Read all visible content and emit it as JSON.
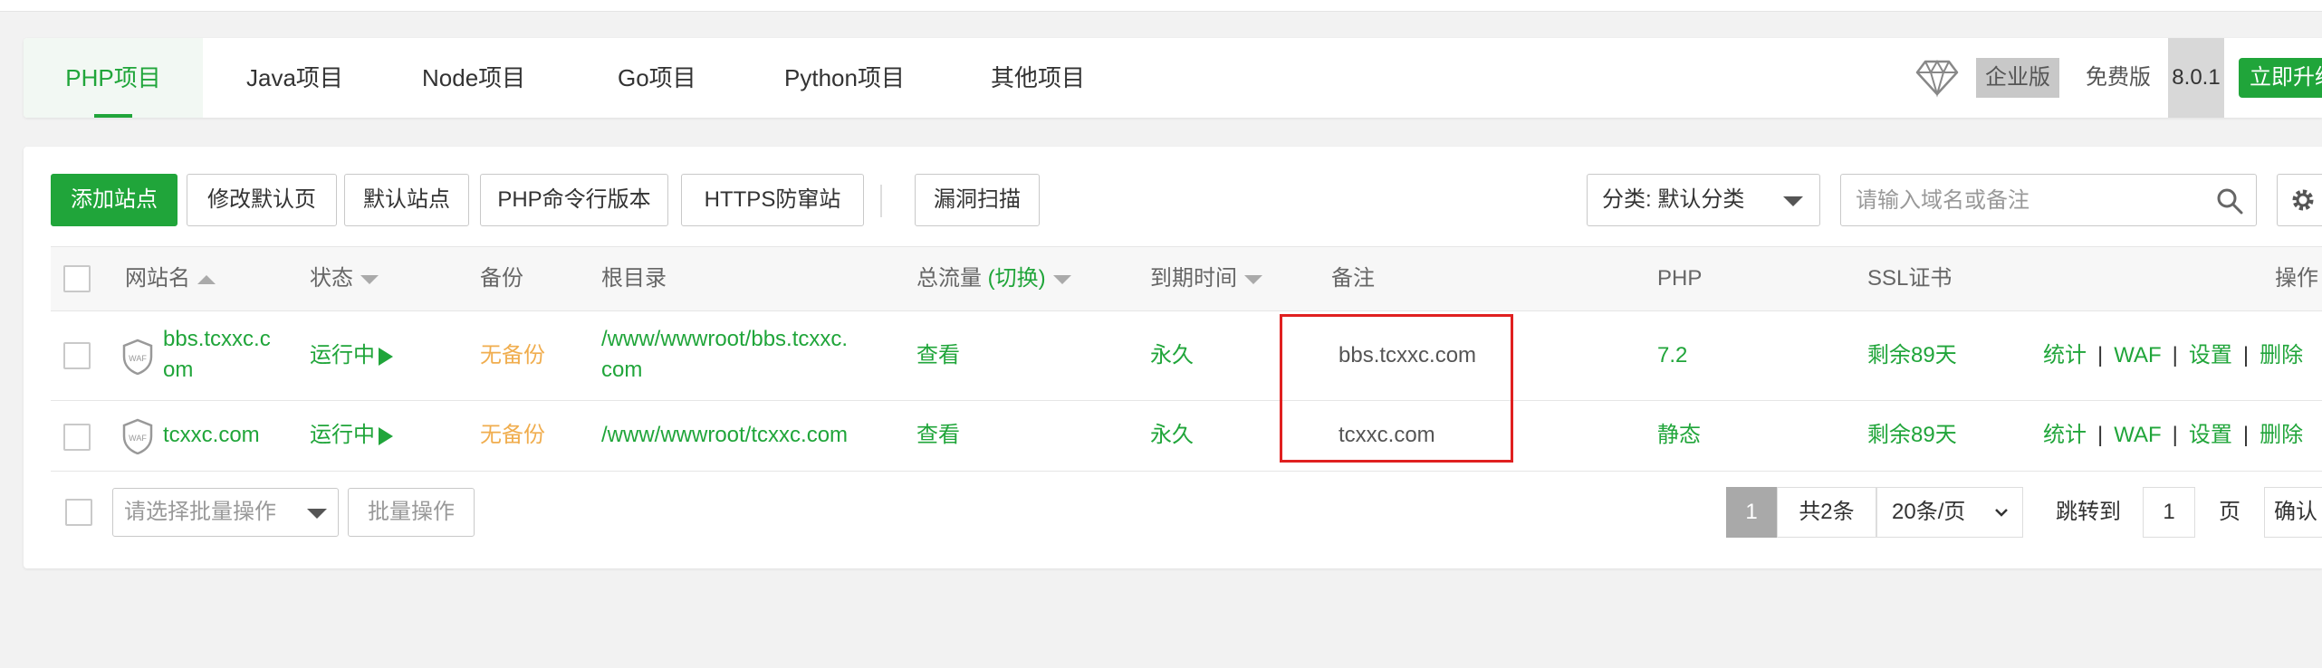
{
  "tabs": [
    {
      "label": "PHP项目",
      "active": true
    },
    {
      "label": "Java项目"
    },
    {
      "label": "Node项目"
    },
    {
      "label": "Go项目"
    },
    {
      "label": "Python项目"
    },
    {
      "label": "其他项目"
    }
  ],
  "header": {
    "enterprise_label": "企业版",
    "free_label": "免费版",
    "version": "8.0.1",
    "upgrade_label": "立即升级"
  },
  "toolbar": {
    "add_site": "添加站点",
    "edit_default_page": "修改默认页",
    "default_site": "默认站点",
    "php_cli_version": "PHP命令行版本",
    "https_antiproxy": "HTTPS防窜站",
    "vuln_scan": "漏洞扫描",
    "category": "分类: 默认分类",
    "search_placeholder": "请输入域名或备注"
  },
  "table": {
    "headers": {
      "site_name": "网站名",
      "status": "状态",
      "backup": "备份",
      "root_dir": "根目录",
      "traffic": "总流量",
      "traffic_toggle": "(切换)",
      "expiry": "到期时间",
      "note": "备注",
      "php": "PHP",
      "ssl": "SSL证书",
      "actions": "操作"
    },
    "rows": [
      {
        "site_line1": "bbs.tcxxc.c",
        "site_line2": "om",
        "status": "运行中",
        "backup": "无备份",
        "root_line1": "/www/wwwroot/bbs.tcxxc.",
        "root_line2": "com",
        "traffic": "查看",
        "expiry": "永久",
        "note": "bbs.tcxxc.com",
        "php": "7.2",
        "ssl": "剩余89天",
        "actions": [
          "统计",
          "WAF",
          "设置",
          "删除"
        ]
      },
      {
        "site": "tcxxc.com",
        "status": "运行中",
        "backup": "无备份",
        "root": "/www/wwwroot/tcxxc.com",
        "traffic": "查看",
        "expiry": "永久",
        "note": "tcxxc.com",
        "php": "静态",
        "ssl": "剩余89天",
        "actions": [
          "统计",
          "WAF",
          "设置",
          "删除"
        ]
      }
    ],
    "waf_badge": "WAF"
  },
  "footer": {
    "batch_placeholder": "请选择批量操作",
    "batch_button": "批量操作",
    "current_page": "1",
    "total": "共2条",
    "page_size": "20条/页",
    "jump_label": "跳转到",
    "jump_value": "1",
    "page_unit": "页",
    "confirm": "确认"
  },
  "colors": {
    "accent": "#20a53a",
    "warning": "#f0ad4e",
    "highlight": "#e02020"
  }
}
